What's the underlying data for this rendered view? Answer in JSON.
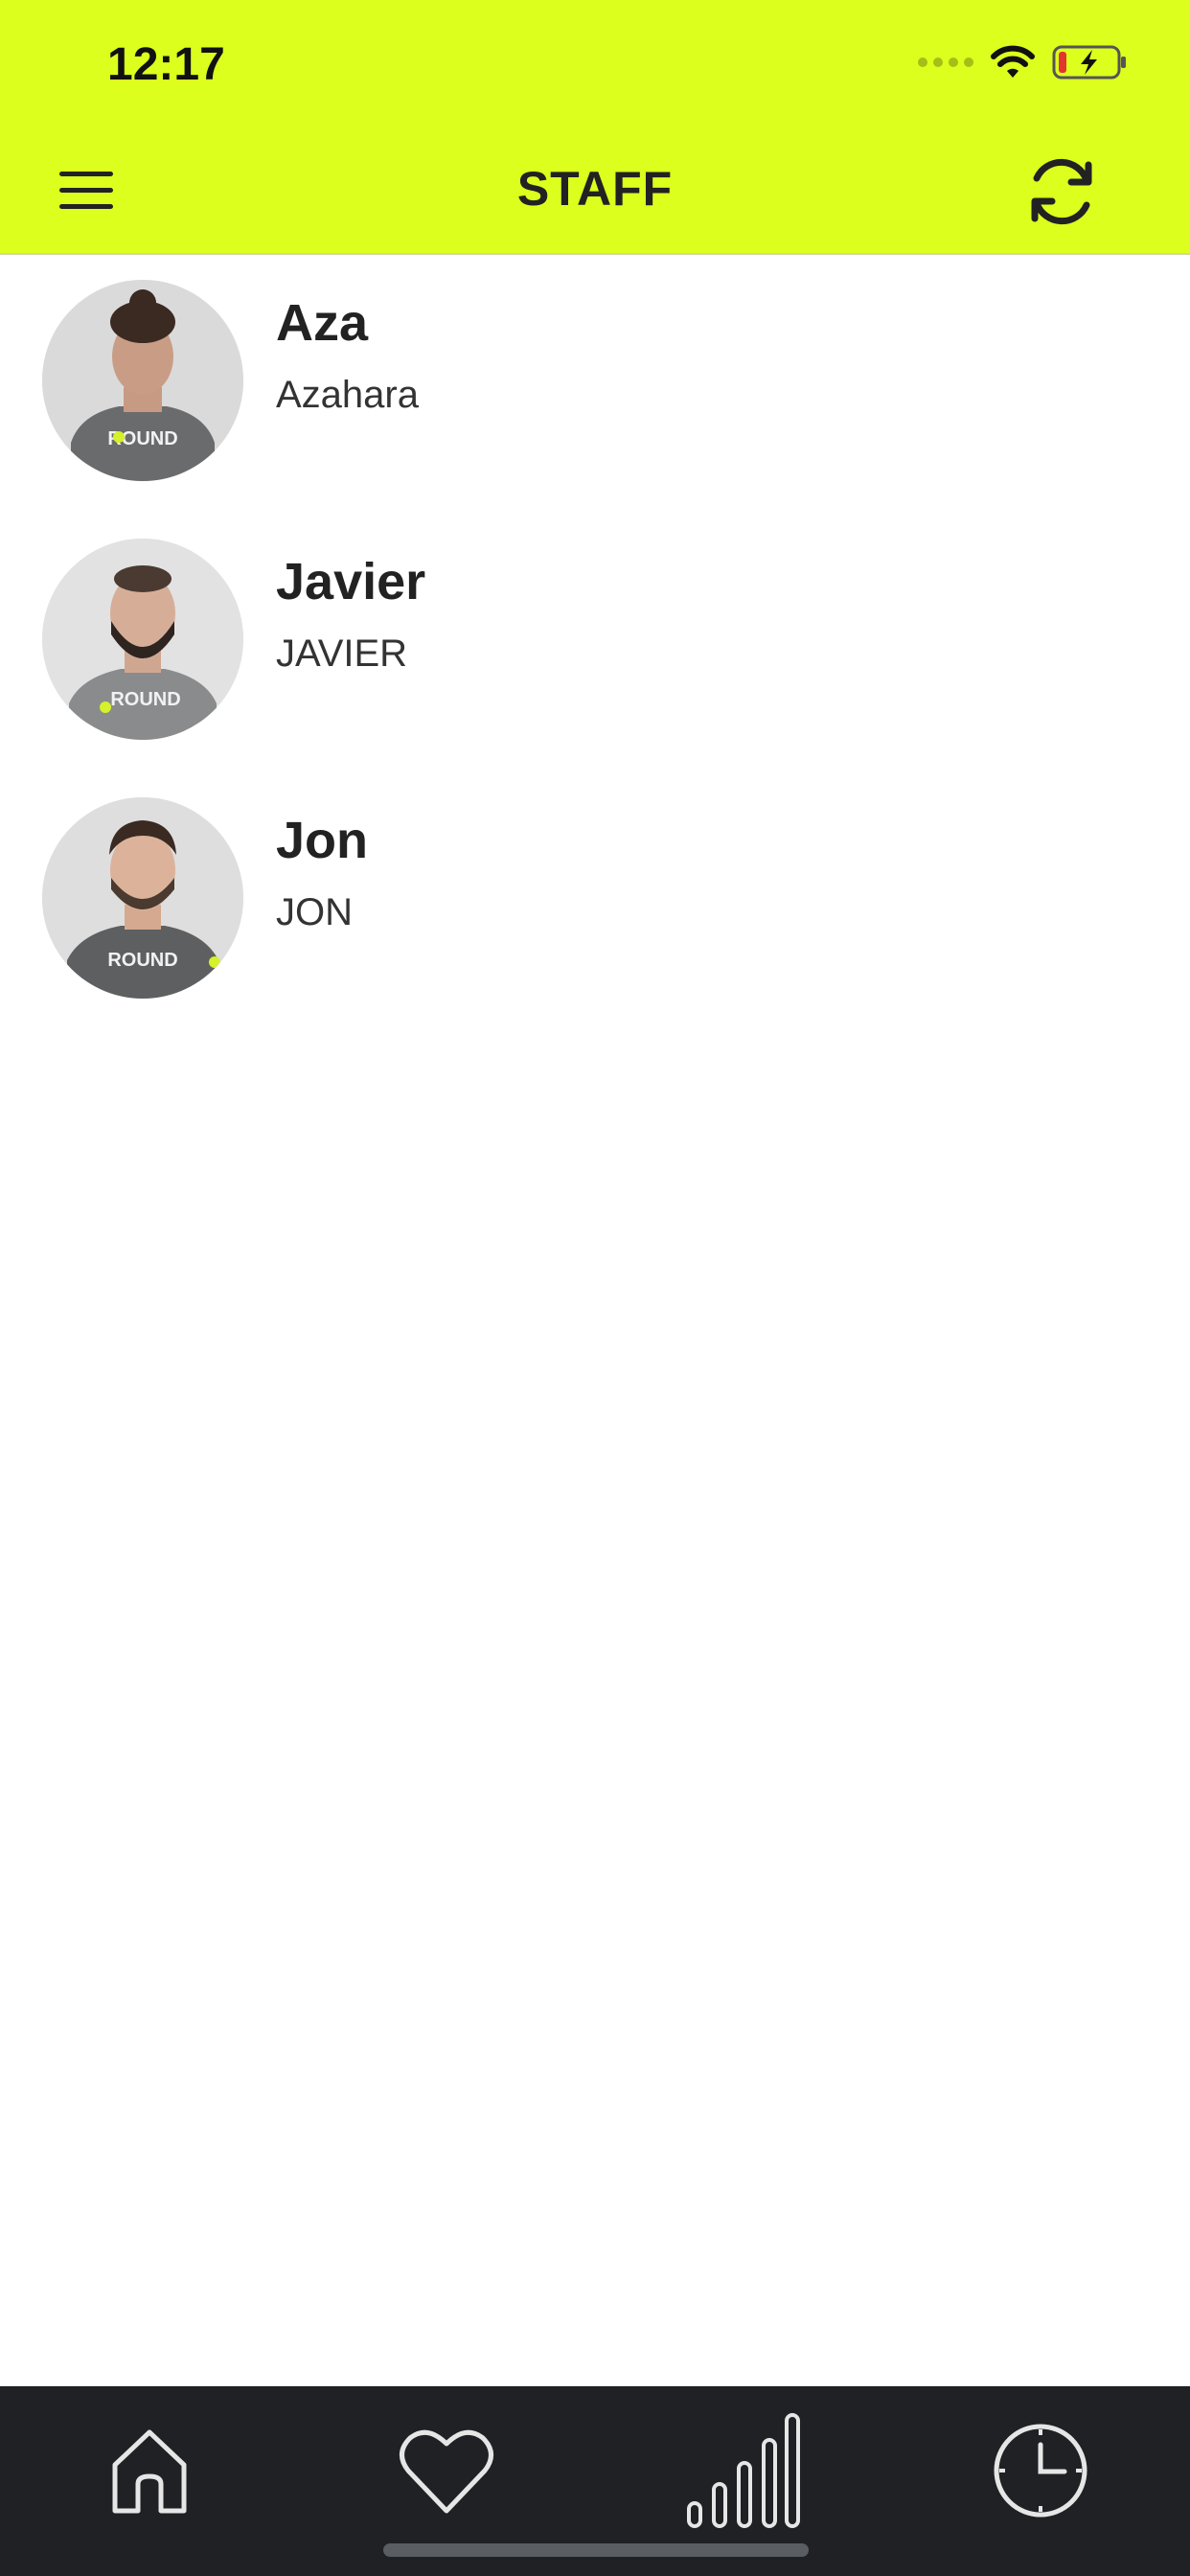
{
  "status_bar": {
    "time": "12:17"
  },
  "header": {
    "title": "STAFF",
    "background_color": "#dcff1e",
    "menu_icon": "hamburger-menu-icon",
    "refresh_icon": "refresh-icon"
  },
  "staff": [
    {
      "name": "Aza",
      "subtitle": "Azahara",
      "avatar": "staff-photo",
      "shirt_text": "ROUND"
    },
    {
      "name": "Javier",
      "subtitle": "JAVIER",
      "avatar": "staff-photo",
      "shirt_text": "ROUND"
    },
    {
      "name": "Jon",
      "subtitle": "JON",
      "avatar": "staff-photo",
      "shirt_text": "ROUND"
    }
  ],
  "tabbar": {
    "background_color": "#1f2124",
    "icons": [
      "home-icon",
      "heart-icon",
      "signal-bars-icon",
      "clock-icon"
    ]
  }
}
